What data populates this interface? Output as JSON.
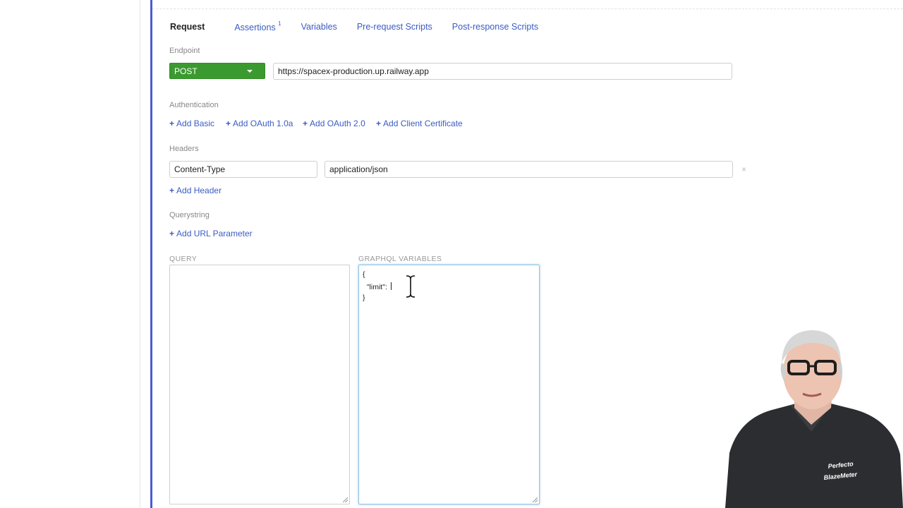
{
  "tabs": [
    {
      "label": "Request"
    },
    {
      "label": "Assertions",
      "badge": "1"
    },
    {
      "label": "Variables"
    },
    {
      "label": "Pre-request Scripts"
    },
    {
      "label": "Post-response Scripts"
    }
  ],
  "endpoint": {
    "label": "Endpoint",
    "method": "POST",
    "url": "https://spacex-production.up.railway.app"
  },
  "authentication": {
    "label": "Authentication",
    "add_basic": "Add Basic",
    "add_oauth1": "Add OAuth 1.0a",
    "add_oauth2": "Add OAuth 2.0",
    "add_client_cert": "Add Client Certificate"
  },
  "headers": {
    "label": "Headers",
    "rows": [
      {
        "name": "Content-Type",
        "value": "application/json"
      }
    ],
    "add_header": "Add Header",
    "remove_symbol": "×"
  },
  "querystring": {
    "label": "Querystring",
    "add_param": "Add URL Parameter"
  },
  "graphql": {
    "query_label": "QUERY",
    "query_value": "",
    "variables_label": "GRAPHQL VARIABLES",
    "variables_lines": [
      "{",
      "  \"limit\": ",
      "}"
    ]
  },
  "presenter": {
    "shirt_logo_1": "Perfecto",
    "shirt_logo_2": "BlazeMeter"
  },
  "colors": {
    "accent": "#3b5cc4",
    "method_bg": "#3b9a2f",
    "rule": "#4b5bd6",
    "focus": "#8fc4e6"
  },
  "icons": {
    "plus": "plus-icon",
    "remove": "close-icon",
    "caret": "chevron-down-icon",
    "cursor": "text-cursor-icon",
    "grip": "resize-grip-icon"
  }
}
